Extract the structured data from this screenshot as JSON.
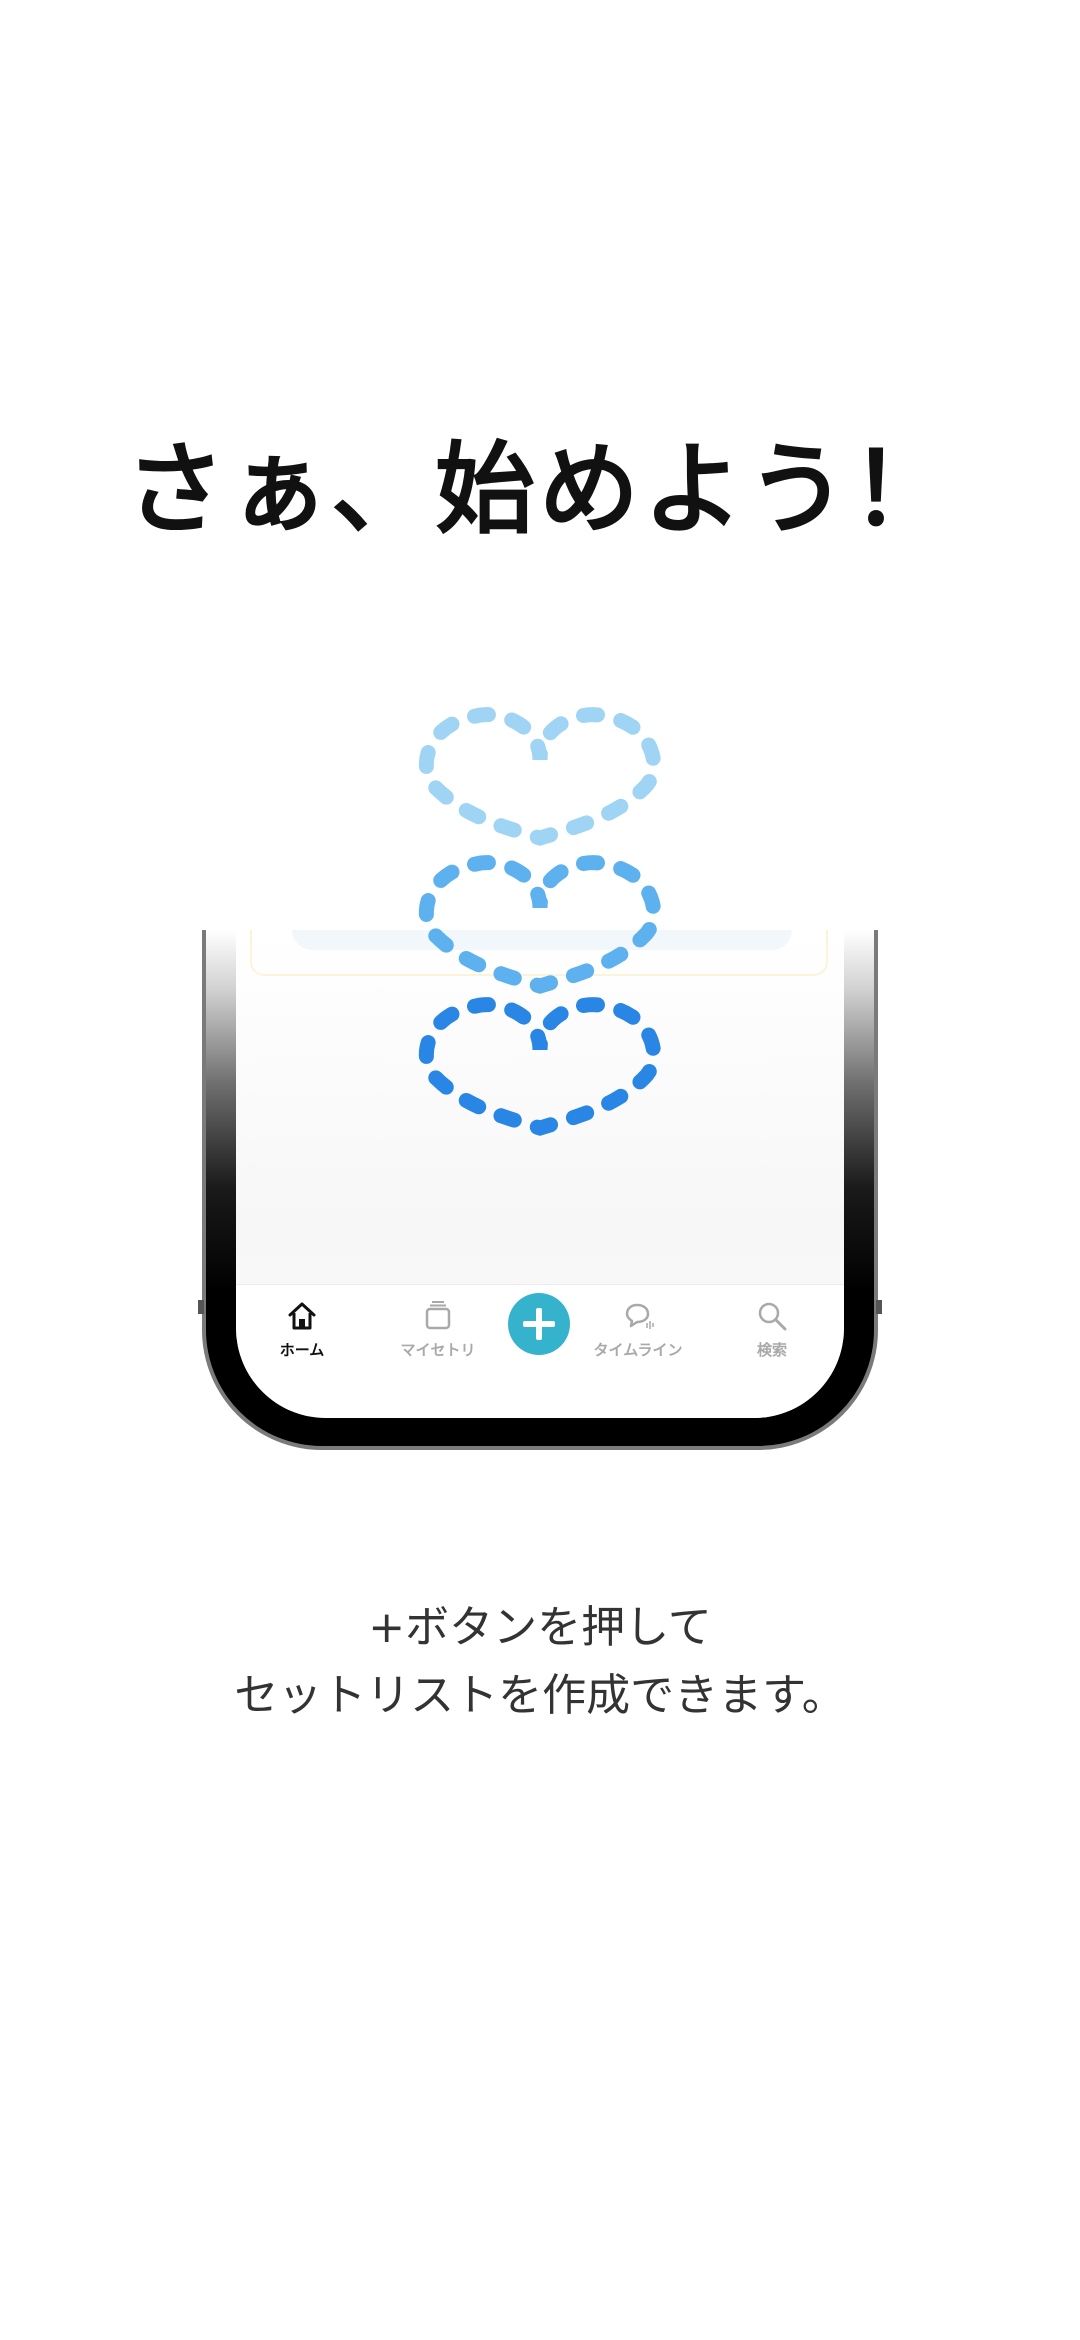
{
  "headline": "さぁ、始めよう！",
  "tabbar": {
    "tabs": [
      {
        "label": "ホーム",
        "icon": "home-icon",
        "active": true
      },
      {
        "label": "マイセトリ",
        "icon": "cards-icon",
        "active": false
      },
      {
        "label": "",
        "icon": "plus-icon",
        "active": false
      },
      {
        "label": "タイムライン",
        "icon": "chat-bubble-icon",
        "active": false
      },
      {
        "label": "検索",
        "icon": "search-icon",
        "active": false
      }
    ]
  },
  "colors": {
    "accent": "#36b3cc",
    "heart_top": "#9fd4f5",
    "heart_middle": "#5cb1ee",
    "heart_bottom": "#2a86e4"
  },
  "instructions": {
    "line1": "+ボタンを押して",
    "line2": "セットリストを作成できます。"
  }
}
